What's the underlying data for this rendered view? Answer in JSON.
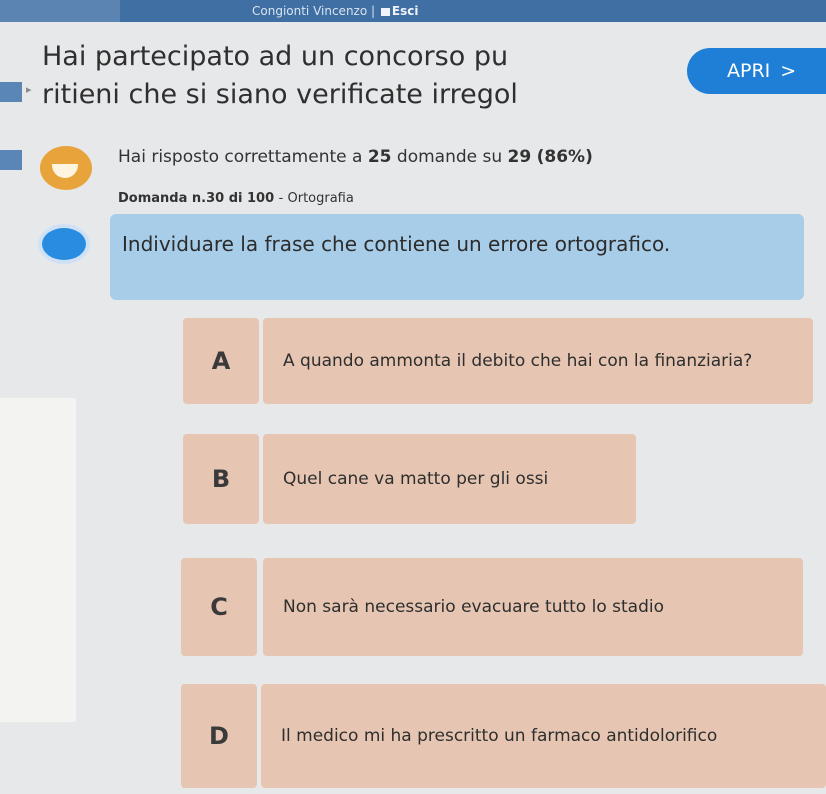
{
  "header": {
    "user": "Congionti Vincenzo",
    "separator": "|",
    "exit_label": "Esci",
    "exit_icon": "exit-icon"
  },
  "banner": {
    "line1": "Hai partecipato ad un concorso pu",
    "line2": "ritieni che si siano verificate irregol",
    "open_label": "APRI",
    "open_chevron": ">"
  },
  "stats": {
    "prefix": "Hai risposto correttamente a",
    "correct": "25",
    "middle": "domande su",
    "total": "29",
    "percent": "(86%)"
  },
  "question": {
    "info_prefix": "Domanda n.30 di 100",
    "info_topic": "- Ortografia",
    "text": "Individuare la frase che contiene un errore ortografico."
  },
  "answers": [
    {
      "letter": "A",
      "text": "A quando ammonta il debito che hai con la finanziaria?"
    },
    {
      "letter": "B",
      "text": "Quel cane va matto per gli ossi"
    },
    {
      "letter": "C",
      "text": "Non sarà necessario evacuare tutto lo stadio"
    },
    {
      "letter": "D",
      "text": "Il medico mi ha prescritto un farmaco antidolorifico"
    }
  ],
  "colors": {
    "accent": "#1f7fd6",
    "question_bg": "#a8cde8",
    "answer_bg": "#e6c6b2",
    "topbar": "#3f6fa3"
  }
}
